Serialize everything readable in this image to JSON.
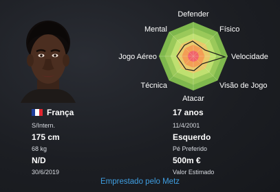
{
  "radar": {
    "labels": {
      "defender": "Defender",
      "mental": "Mental",
      "fisico": "Físico",
      "jogo_aereo": "Jogo Aéreo",
      "velocidade": "Velocidade",
      "tecnica": "Técnica",
      "visao_de_jogo": "Visão de Jogo",
      "atacar": "Atacar"
    },
    "ring_colors": [
      "#7fb84d",
      "#9ac95a",
      "#bfe070",
      "#e9c96a",
      "#f39e55",
      "#f2626a"
    ]
  },
  "player": {
    "nationality": "França",
    "flag_colors": [
      "#1f3e9a",
      "#ffffff",
      "#e1252f"
    ],
    "intl_status": "S/Intern.",
    "height": "175 cm",
    "weight": "68 kg",
    "contract_end_value": "N/D",
    "contract_end_date": "30/6/2019",
    "age": "17 anos",
    "birth_date": "11/4/2001",
    "preferred_foot": "Esquerdo",
    "preferred_foot_label": "Pé Preferido",
    "value": "500m €",
    "value_label": "Valor Estimado"
  },
  "loan_link": "Emprestado pelo Metz"
}
